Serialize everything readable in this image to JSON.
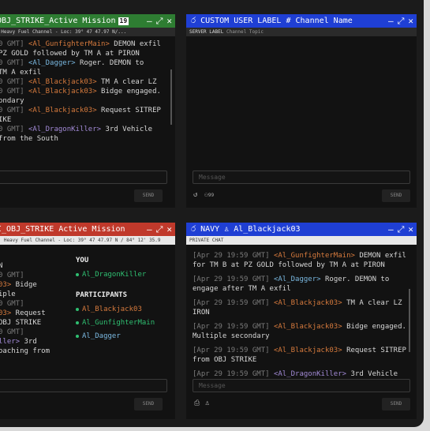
{
  "panel1": {
    "title": "OBJ_STRIKE_Active Mission",
    "badge": "19",
    "subtitle": ": Heavy Fuel Channel - Loc: 39° 47 47.97 N/...",
    "lines": [
      {
        "ts": "0 GMT]",
        "who": "<Al_GunfighterMain>",
        "text": " DEMON exfil"
      },
      {
        "ts": "",
        "who": "",
        "text": "PZ GOLD followed by TM A at PIRON"
      },
      {
        "ts": "0 GMT]",
        "who": "<Al_Dagger>",
        "text": " Roger. DEMON to"
      },
      {
        "ts": "",
        "who": "",
        "text": "TM A exfil"
      },
      {
        "ts": "0 GMT]",
        "who": "<Al_Blackjack03>",
        "text": " TM A clear LZ"
      },
      {
        "ts": "0 GMT]",
        "who": "<Al_Blackjack03>",
        "text": " Bidge engaged."
      },
      {
        "ts": "",
        "who": "",
        "text": "ondary"
      },
      {
        "ts": "0 GMT]",
        "who": "<Al_Blackjack03>",
        "text": " Request SITREP"
      },
      {
        "ts": "",
        "who": "",
        "text": "IKE"
      },
      {
        "ts": "0 GMT]",
        "who": "<Al_DragonKiller>",
        "text": " 3rd Vehicle"
      },
      {
        "ts": "",
        "who": "",
        "text": "from the South"
      }
    ],
    "send": "SEND"
  },
  "panel2": {
    "title": "CUSTOM USER LABEL",
    "channel": "Channel Name",
    "server_label": "SERVER LABEL",
    "topic": "Channel Topic",
    "placeholder": "Message",
    "user_count": "99",
    "send": "SEND"
  },
  "panel3": {
    "title": "I_OBJ_STRIKE Active Mission",
    "subtitle": "I: Heavy Fuel Channel - Loc: 39° 47 47.97 N / 84° 12' 35.9",
    "lines": [
      {
        "ts": "",
        "who": "",
        "text": "N"
      },
      {
        "ts": "0 GMT]",
        "who": "",
        "text": ""
      },
      {
        "ts": "",
        "who": "03>",
        "text": " Bidge"
      },
      {
        "ts": "",
        "who": "",
        "text": "iple"
      },
      {
        "ts": "0 GMT]",
        "who": "",
        "text": ""
      },
      {
        "ts": "",
        "who": "03>",
        "text": " Request"
      },
      {
        "ts": "",
        "who": "",
        "text": "OBJ STRIKE"
      },
      {
        "ts": "0 GMT]",
        "who": "",
        "text": ""
      },
      {
        "ts": "",
        "who": "ller>",
        "text": " 3rd"
      },
      {
        "ts": "",
        "who": "",
        "text": "oaching from"
      }
    ],
    "you_label": "YOU",
    "you": "Al_DragonKiller",
    "participants_label": "PARTICIPANTS",
    "participants": [
      "Al_Blackjack03",
      "Al_GunfighterMain",
      "Al_Dagger"
    ],
    "send": "SEND"
  },
  "panel4": {
    "title": "NAVY",
    "user": "Al_Blackjack03",
    "subtitle": "PRIVATE CHAT",
    "messages": [
      {
        "ts": "[Apr 29 19:59 GMT]",
        "who": "<Al_GunfighterMain>",
        "text": " DEMON exfil for TM B at PZ GOLD followed by TM A at PIRON"
      },
      {
        "ts": "[Apr 29 19:59 GMT]",
        "who": "<Al_Dagger>",
        "text": " Roger. DEMON to engage after TM A exfil"
      },
      {
        "ts": "[Apr 29 19:59 GMT]",
        "who": "<Al_Blackjack03>",
        "text": " TM A clear LZ IRON"
      },
      {
        "ts": "[Apr 29 19:59 GMT]",
        "who": "<Al_Blackjack03>",
        "text": " Bidge engaged. Multiple secondary"
      },
      {
        "ts": "[Apr 29 19:59 GMT]",
        "who": "<Al_Blackjack03>",
        "text": " Request SITREP from OBJ STRIKE"
      },
      {
        "ts": "[Apr 29 19:59 GMT]",
        "who": "<Al_DragonKiller>",
        "text": " 3rd Vehicle approaching from the South"
      }
    ],
    "placeholder": "Message",
    "send": "SEND"
  },
  "colors": {
    "green": "#2e7d32",
    "navy": "#1f3fd4",
    "red": "#c0392b",
    "accent_orange": "#d67a3d",
    "accent_green": "#2fbf71"
  },
  "icons": {
    "minimize": "minimize-icon",
    "expand": "expand-icon",
    "close": "close-icon",
    "history": "history-icon",
    "users": "users-icon",
    "file": "file-icon",
    "user": "user-icon"
  }
}
